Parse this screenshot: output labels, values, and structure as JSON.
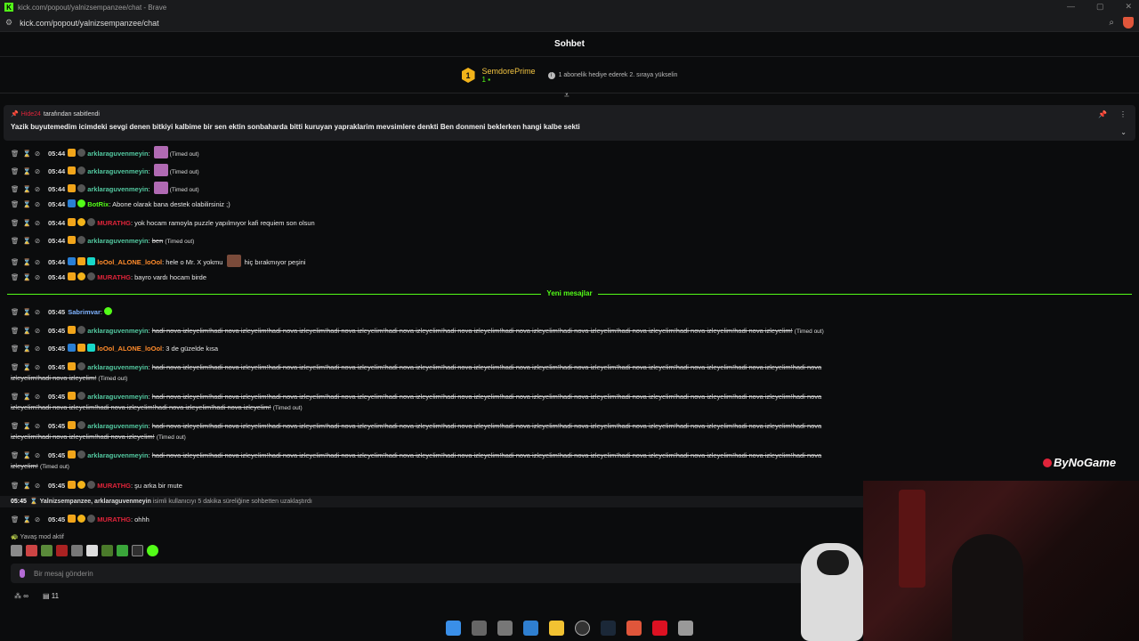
{
  "window": {
    "title": "kick.com/popout/yalnizsempanzee/chat - Brave",
    "url": "kick.com/popout/yalnizsempanzee/chat"
  },
  "chat": {
    "title": "Sohbet"
  },
  "gifter": {
    "rank": "1",
    "name": "SemdorePrime",
    "count": "1",
    "hint": "1 abonelik hediye ederek 2. sıraya yükselin"
  },
  "pinned": {
    "by_user": "Hide24",
    "by_suffix": "tarafından sabitlendi",
    "text": "Yazik buyutemedim icimdeki sevgi denen bitkiyi kalbime bir sen ektin sonbaharda bitti kuruyan yapraklarim mevsimlere denkti Ben donmeni beklerken hangi kalbe sekti"
  },
  "messages": [
    {
      "time": "05:44",
      "user": "arklaraguvenmeyin",
      "text": "",
      "status": "(Timed out)"
    },
    {
      "time": "05:44",
      "user": "arklaraguvenmeyin",
      "text": "",
      "status": "(Timed out)"
    },
    {
      "time": "05:44",
      "user": "arklaraguvenmeyin",
      "text": "",
      "status": "(Timed out)"
    },
    {
      "time": "05:44",
      "user": "BotRix",
      "text": "Abone olarak bana destek olabilirsiniz ;)",
      "status": ""
    },
    {
      "time": "05:44",
      "user": "MURATHG",
      "text": "yok hocam ramoyla puzzle yapılmıyor kafi requiem son olsun",
      "status": ""
    },
    {
      "time": "05:44",
      "user": "arklaraguvenmeyin",
      "text": "ben",
      "status": "(Timed out)"
    },
    {
      "time": "05:44",
      "user": "loOol_ALONE_loOol",
      "text": "hele o Mr. X yokmu",
      "text2": "hiç bırakmıyor peşini",
      "status": ""
    },
    {
      "time": "05:44",
      "user": "MURATHG",
      "text": "bayro vardı hocam birde",
      "status": ""
    },
    {
      "time": "05:45",
      "user": "Sabrimvar",
      "text": "",
      "status": ""
    },
    {
      "time": "05:45",
      "user": "arklaraguvenmeyin",
      "text": "hadi nova izleyelim!hadi nova izleyelim!hadi nova izleyelim!hadi nova izleyelim!hadi nova izleyelim!hadi nova izleyelim!hadi nova izleyelim!hadi nova izleyelim!hadi nova izleyelim!hadi nova izleyelim!hadi nova izleyelim!",
      "status": "(Timed out)"
    },
    {
      "time": "05:45",
      "user": "loOol_ALONE_loOol",
      "text": "3 de güzelde kısa",
      "status": ""
    },
    {
      "time": "05:45",
      "user": "arklaraguvenmeyin",
      "text": "hadi nova izleyelim!hadi nova izleyelim!hadi nova izleyelim!hadi nova izleyelim!hadi nova izleyelim!hadi nova izleyelim!hadi nova izleyelim!hadi nova izleyelim!hadi nova izleyelim!hadi nova izleyelim!hadi nova izleyelim!hadi nova",
      "text2": "izleyelim!hadi nova izleyelim!",
      "status": "(Timed out)"
    },
    {
      "time": "05:45",
      "user": "arklaraguvenmeyin",
      "text": "hadi nova izleyelim!hadi nova izleyelim!hadi nova izleyelim!hadi nova izleyelim!hadi nova izleyelim!hadi nova izleyelim!hadi nova izleyelim!hadi nova izleyelim!hadi nova izleyelim!hadi nova izleyelim!hadi nova izleyelim!hadi nova",
      "text2": "izleyelim!hadi nova izleyelim!hadi nova izleyelim!hadi nova izleyelim!hadi nova izleyelim!",
      "status": "(Timed out)"
    },
    {
      "time": "05:45",
      "user": "arklaraguvenmeyin",
      "text": "hadi nova izleyelim!hadi nova izleyelim!hadi nova izleyelim!hadi nova izleyelim!hadi nova izleyelim!hadi nova izleyelim!hadi nova izleyelim!hadi nova izleyelim!hadi nova izleyelim!hadi nova izleyelim!hadi nova izleyelim!hadi nova",
      "text2": "izleyelim!hadi nova izleyelim!hadi nova izleyelim!",
      "status": "(Timed out)"
    },
    {
      "time": "05:45",
      "user": "arklaraguvenmeyin",
      "text": "hadi nova izleyelim!hadi nova izleyelim!hadi nova izleyelim!hadi nova izleyelim!hadi nova izleyelim!hadi nova izleyelim!hadi nova izleyelim!hadi nova izleyelim!hadi nova izleyelim!hadi nova izleyelim!hadi nova izleyelim!hadi nova",
      "text2": "izleyelim!",
      "status": "(Timed out)"
    },
    {
      "time": "05:45",
      "user": "MURATHG",
      "text": "şu arka bir mute",
      "status": ""
    },
    {
      "time": "05:45",
      "user": "MURATHG",
      "text": "ohhh",
      "status": ""
    }
  ],
  "new_messages_label": "Yeni mesajlar",
  "mod_notice": {
    "time": "05:45",
    "actors": "Yalnizsempanzee, arklaraguvenmeyin",
    "text": "isimli kullanıcıyı 5 dakika süreliğine sohbetten uzaklaştırdı"
  },
  "slow_mode": "Yavaş mod aktif",
  "input": {
    "placeholder": "Bir mesaj gönderin"
  },
  "bottom": {
    "infinity": "∞",
    "count": "11"
  },
  "watermark": "ByNoGame",
  "colors": {
    "kick_green": "#53fc18",
    "gold": "#f2b31a",
    "red": "#e0243a"
  }
}
